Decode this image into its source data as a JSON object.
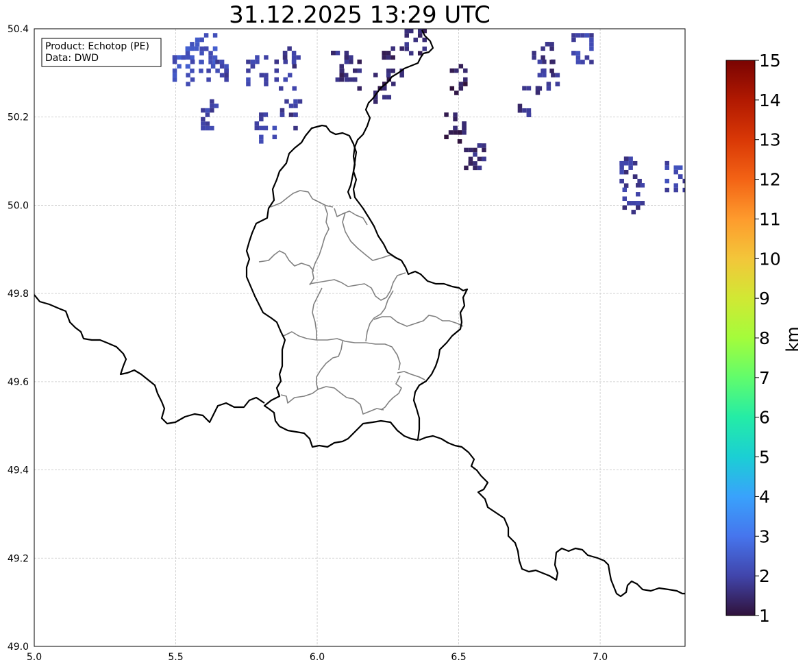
{
  "title": "31.12.2025 13:29 UTC",
  "info_box": {
    "product_line": "Product: Echotop (PE)",
    "data_line": "Data: DWD"
  },
  "colorbar": {
    "label": "km",
    "min": 1,
    "max": 15,
    "ticks": [
      "1",
      "2",
      "3",
      "4",
      "5",
      "6",
      "7",
      "8",
      "9",
      "10",
      "11",
      "12",
      "13",
      "14",
      "15"
    ],
    "colormap": [
      "#30123b",
      "#4145ab",
      "#4675ed",
      "#39a2fc",
      "#1bcfd4",
      "#24eca6",
      "#61fc6c",
      "#a4fc3b",
      "#d1e834",
      "#f3c63a",
      "#fe9b2d",
      "#f36315",
      "#d93806",
      "#b11901",
      "#7a0402"
    ]
  },
  "chart_data": {
    "type": "heatmap",
    "title": "31.12.2025 13:29 UTC",
    "xlim": [
      5.0,
      7.3
    ],
    "ylim": [
      49.0,
      50.4
    ],
    "x_ticks": [
      "5.0",
      "5.5",
      "6.0",
      "6.5",
      "7.0"
    ],
    "y_ticks": [
      "50.4",
      "50.2",
      "50.0",
      "49.8",
      "49.6",
      "49.4",
      "49.2",
      "49.0"
    ],
    "grid": true,
    "value_unit": "km",
    "value_range": [
      1,
      15
    ],
    "echo_cells": [
      {
        "lon": 5.55,
        "lat": 50.34,
        "value": 2.4
      },
      {
        "lon": 5.6,
        "lat": 50.36,
        "value": 2.3
      },
      {
        "lon": 5.52,
        "lat": 50.31,
        "value": 2.3
      },
      {
        "lon": 5.64,
        "lat": 50.32,
        "value": 2.0
      },
      {
        "lon": 5.62,
        "lat": 50.21,
        "value": 2.0
      },
      {
        "lon": 5.78,
        "lat": 50.31,
        "value": 2.0
      },
      {
        "lon": 5.81,
        "lat": 50.18,
        "value": 2.0
      },
      {
        "lon": 5.88,
        "lat": 50.3,
        "value": 1.8
      },
      {
        "lon": 5.91,
        "lat": 50.33,
        "value": 1.8
      },
      {
        "lon": 5.9,
        "lat": 50.21,
        "value": 1.8
      },
      {
        "lon": 6.08,
        "lat": 50.32,
        "value": 1.6
      },
      {
        "lon": 6.11,
        "lat": 50.3,
        "value": 1.5
      },
      {
        "lon": 6.26,
        "lat": 50.33,
        "value": 1.4
      },
      {
        "lon": 6.23,
        "lat": 50.27,
        "value": 1.4
      },
      {
        "lon": 6.34,
        "lat": 50.38,
        "value": 1.5
      },
      {
        "lon": 6.5,
        "lat": 50.29,
        "value": 1.2
      },
      {
        "lon": 6.48,
        "lat": 50.18,
        "value": 1.3
      },
      {
        "lon": 6.55,
        "lat": 50.11,
        "value": 1.5
      },
      {
        "lon": 6.79,
        "lat": 50.34,
        "value": 1.6
      },
      {
        "lon": 6.81,
        "lat": 50.3,
        "value": 1.7
      },
      {
        "lon": 6.93,
        "lat": 50.36,
        "value": 2.0
      },
      {
        "lon": 6.74,
        "lat": 50.24,
        "value": 1.6
      },
      {
        "lon": 7.1,
        "lat": 50.08,
        "value": 1.8
      },
      {
        "lon": 7.26,
        "lat": 50.07,
        "value": 2.0
      },
      {
        "lon": 7.11,
        "lat": 50.02,
        "value": 1.8
      }
    ]
  }
}
